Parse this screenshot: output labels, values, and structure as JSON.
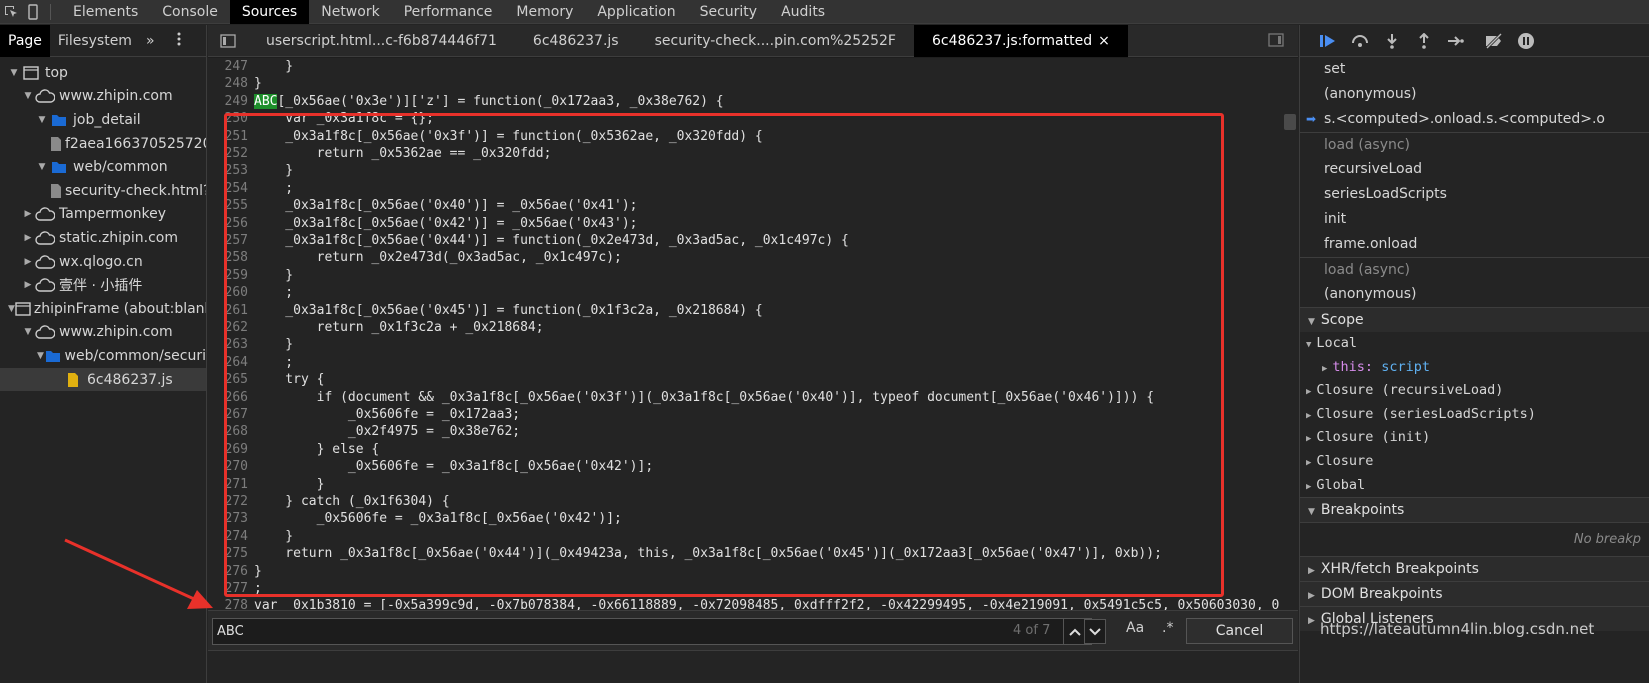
{
  "toolbar": {
    "tabs": [
      "Elements",
      "Console",
      "Sources",
      "Network",
      "Performance",
      "Memory",
      "Application",
      "Security",
      "Audits"
    ],
    "active_tab": "Sources"
  },
  "navigator": {
    "tabs": [
      "Page",
      "Filesystem"
    ],
    "more": "»",
    "tree": [
      {
        "label": "top",
        "depth": 0,
        "icon": "frame-icon",
        "open": true
      },
      {
        "label": "www.zhipin.com",
        "depth": 1,
        "icon": "cloud-icon",
        "open": true
      },
      {
        "label": "job_detail",
        "depth": 2,
        "icon": "folder-icon",
        "open": true
      },
      {
        "label": "f2aea166370525720X",
        "depth": 3,
        "icon": "file-icon"
      },
      {
        "label": "web/common",
        "depth": 2,
        "icon": "folder-icon",
        "open": true
      },
      {
        "label": "security-check.html?s",
        "depth": 3,
        "icon": "file-icon"
      },
      {
        "label": "Tampermonkey",
        "depth": 1,
        "icon": "cloud-icon",
        "open": false
      },
      {
        "label": "static.zhipin.com",
        "depth": 1,
        "icon": "cloud-icon",
        "open": false
      },
      {
        "label": "wx.qlogo.cn",
        "depth": 1,
        "icon": "cloud-icon",
        "open": false
      },
      {
        "label": "壹伴 · 小插件",
        "depth": 1,
        "icon": "cloud-icon",
        "open": false
      },
      {
        "label": "zhipinFrame (about:blank",
        "depth": 0,
        "icon": "frame-icon",
        "open": true
      },
      {
        "label": "www.zhipin.com",
        "depth": 1,
        "icon": "cloud-icon",
        "open": true
      },
      {
        "label": "web/common/securi",
        "depth": 2,
        "icon": "folder-icon",
        "open": true
      },
      {
        "label": "6c486237.js",
        "depth": 3,
        "icon": "js-file-icon",
        "selected": true
      }
    ]
  },
  "editor": {
    "file_tabs": [
      "userscript.html...c-f6b874446f71",
      "6c486237.js",
      "security-check....pin.com%25252F",
      "6c486237.js:formatted"
    ],
    "active_file_tab": "6c486237.js:formatted",
    "close_glyph": "×",
    "lines": [
      {
        "n": "247",
        "code": "    }"
      },
      {
        "n": "248",
        "code": "}"
      },
      {
        "n": "249",
        "code": "[_0x56ae('0x3e')]['z'] = function(_0x172aa3, _0x38e762) {",
        "hl": "ABC"
      },
      {
        "n": "250",
        "code": "    var _0x3a1f8c = {};"
      },
      {
        "n": "251",
        "code": "    _0x3a1f8c[_0x56ae('0x3f')] = function(_0x5362ae, _0x320fdd) {"
      },
      {
        "n": "252",
        "code": "        return _0x5362ae == _0x320fdd;"
      },
      {
        "n": "253",
        "code": "    }"
      },
      {
        "n": "254",
        "code": "    ;"
      },
      {
        "n": "255",
        "code": "    _0x3a1f8c[_0x56ae('0x40')] = _0x56ae('0x41');"
      },
      {
        "n": "256",
        "code": "    _0x3a1f8c[_0x56ae('0x42')] = _0x56ae('0x43');"
      },
      {
        "n": "257",
        "code": "    _0x3a1f8c[_0x56ae('0x44')] = function(_0x2e473d, _0x3ad5ac, _0x1c497c) {"
      },
      {
        "n": "258",
        "code": "        return _0x2e473d(_0x3ad5ac, _0x1c497c);"
      },
      {
        "n": "259",
        "code": "    }"
      },
      {
        "n": "260",
        "code": "    ;"
      },
      {
        "n": "261",
        "code": "    _0x3a1f8c[_0x56ae('0x45')] = function(_0x1f3c2a, _0x218684) {"
      },
      {
        "n": "262",
        "code": "        return _0x1f3c2a + _0x218684;"
      },
      {
        "n": "263",
        "code": "    }"
      },
      {
        "n": "264",
        "code": "    ;"
      },
      {
        "n": "265",
        "code": "    try {"
      },
      {
        "n": "266",
        "code": "        if (document && _0x3a1f8c[_0x56ae('0x3f')](_0x3a1f8c[_0x56ae('0x40')], typeof document[_0x56ae('0x46')])) {"
      },
      {
        "n": "267",
        "code": "            _0x5606fe = _0x172aa3;"
      },
      {
        "n": "268",
        "code": "            _0x2f4975 = _0x38e762;"
      },
      {
        "n": "269",
        "code": "        } else {"
      },
      {
        "n": "270",
        "code": "            _0x5606fe = _0x3a1f8c[_0x56ae('0x42')];"
      },
      {
        "n": "271",
        "code": "        }"
      },
      {
        "n": "272",
        "code": "    } catch (_0x1f6304) {"
      },
      {
        "n": "273",
        "code": "        _0x5606fe = _0x3a1f8c[_0x56ae('0x42')];"
      },
      {
        "n": "274",
        "code": "    }"
      },
      {
        "n": "275",
        "code": "    return _0x3a1f8c[_0x56ae('0x44')](_0x49423a, this, _0x3a1f8c[_0x56ae('0x45')](_0x172aa3[_0x56ae('0x47')], 0xb));"
      },
      {
        "n": "276",
        "code": "}"
      },
      {
        "n": "277",
        "code": ";"
      },
      {
        "n": "278",
        "code": "var _0x1b3810 = [-0x5a399c9d, -0x7b078384, -0x66118889, -0x72098485, 0xdfff2f2, -0x42299495, -0x4e219091, 0x5491c5c5, 0x50603030, 0"
      }
    ]
  },
  "search": {
    "value": "ABC",
    "match_count": "4 of 7",
    "match_case_label": "Aa",
    "regex_label": ".*",
    "cancel_label": "Cancel"
  },
  "debugger": {
    "call_stack": [
      {
        "label": "set",
        "type": "frame"
      },
      {
        "label": "(anonymous)",
        "type": "frame"
      },
      {
        "label": "s.<computed>.onload.s.<computed>.o",
        "type": "frame",
        "current": true
      },
      {
        "label": "load (async)",
        "type": "async"
      },
      {
        "label": "recursiveLoad",
        "type": "frame"
      },
      {
        "label": "seriesLoadScripts",
        "type": "frame"
      },
      {
        "label": "init",
        "type": "frame"
      },
      {
        "label": "frame.onload",
        "type": "frame"
      },
      {
        "label": "load (async)",
        "type": "async"
      },
      {
        "label": "(anonymous)",
        "type": "frame"
      }
    ],
    "scope_title": "Scope",
    "scope": {
      "local_label": "Local",
      "this_key": "this:",
      "this_value": "script",
      "closures": [
        "Closure (recursiveLoad)",
        "Closure (seriesLoadScripts)",
        "Closure (init)",
        "Closure"
      ],
      "global_label": "Global"
    },
    "breakpoints_title": "Breakpoints",
    "no_breakpoints": "No breakp",
    "xhr_title": "XHR/fetch Breakpoints",
    "dom_title": "DOM Breakpoints",
    "global_listeners_title": "Global Listeners"
  },
  "watermark": "https://lateautumn4lin.blog.csdn.net",
  "colors": {
    "highlight": "#1e8f2b",
    "annotation_red": "#e8312a",
    "accent_blue": "#4a8ef2"
  }
}
